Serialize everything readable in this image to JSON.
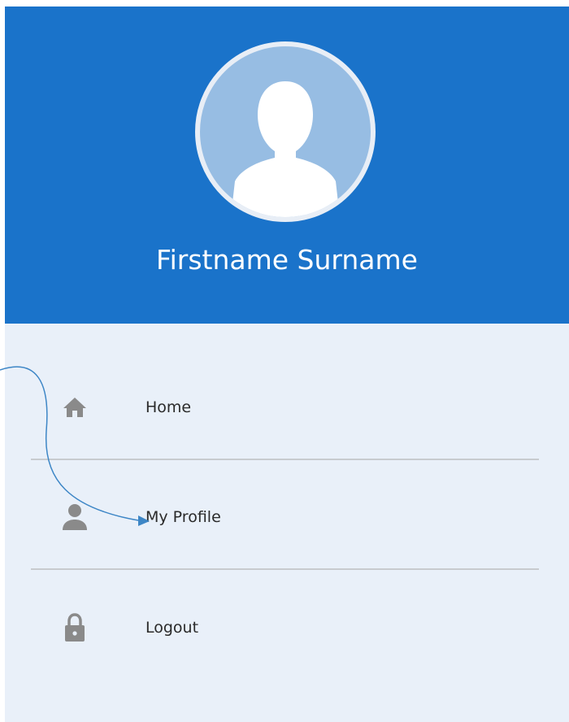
{
  "drawer": {
    "header": {
      "user_name": "Firstname Surname",
      "avatar_icon": "user-silhouette-icon"
    },
    "menu": {
      "items": [
        {
          "label": "Home",
          "icon": "home-icon"
        },
        {
          "label": "My Profile",
          "icon": "person-icon"
        },
        {
          "label": "Logout",
          "icon": "lock-icon"
        }
      ]
    }
  },
  "colors": {
    "header_background": "#1a73ca",
    "drawer_background": "#e9f0f9",
    "avatar_background": "#97bde3",
    "icon_color": "#8a8a8a",
    "annotation_arrow": "#3d86c6"
  }
}
